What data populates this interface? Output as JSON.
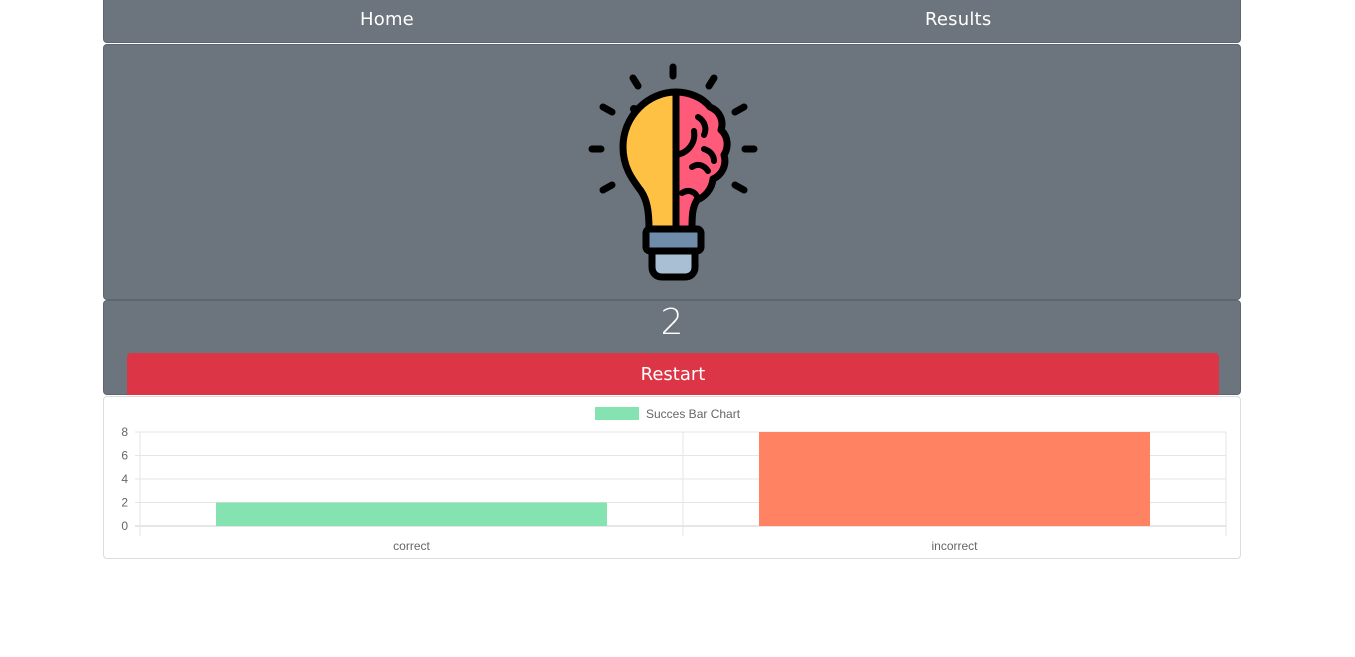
{
  "nav": {
    "home_label": "Home",
    "results_label": "Results"
  },
  "hero": {
    "icon": "lightbulb-brain-icon"
  },
  "score": {
    "value": "2"
  },
  "restart": {
    "label": "Restart"
  },
  "colors": {
    "card_bg": "#6c757d",
    "restart_bg": "#dc3545",
    "correct_bar": "#84e3b0",
    "incorrect_bar": "#ff8262"
  },
  "chart_data": {
    "type": "bar",
    "categories": [
      "correct",
      "incorrect"
    ],
    "series": [
      {
        "name": "Succes Bar Chart",
        "values": [
          2,
          8
        ],
        "colors": [
          "#84e3b0",
          "#ff8262"
        ]
      }
    ],
    "ylim": [
      0,
      8
    ],
    "yticks": [
      0,
      2,
      4,
      6,
      8
    ],
    "grid": true,
    "legend": "top"
  }
}
